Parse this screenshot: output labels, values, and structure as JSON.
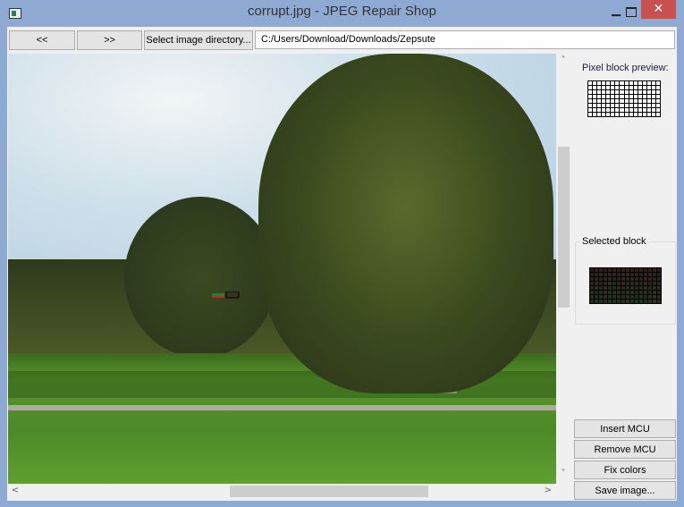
{
  "window": {
    "title": "corrupt.jpg - JPEG Repair Shop",
    "minimize": "▁",
    "close": "✕"
  },
  "toolbar": {
    "prev_label": "<<",
    "next_label": ">>",
    "select_dir_label": "Select image directory...",
    "path_value": "C:/Users/Download/Downloads/Zepsute"
  },
  "scroll": {
    "up": "˄",
    "down": "˅",
    "left": "<",
    "right": ">"
  },
  "panel": {
    "preview_label": "Pixel block preview:",
    "selected_label": "Selected block",
    "insert_label": "Insert MCU",
    "remove_label": "Remove MCU",
    "fix_label": "Fix colors",
    "save_label": "Save image..."
  },
  "colors": {
    "window_frame": "#8eaad2",
    "close_button": "#c75050"
  }
}
